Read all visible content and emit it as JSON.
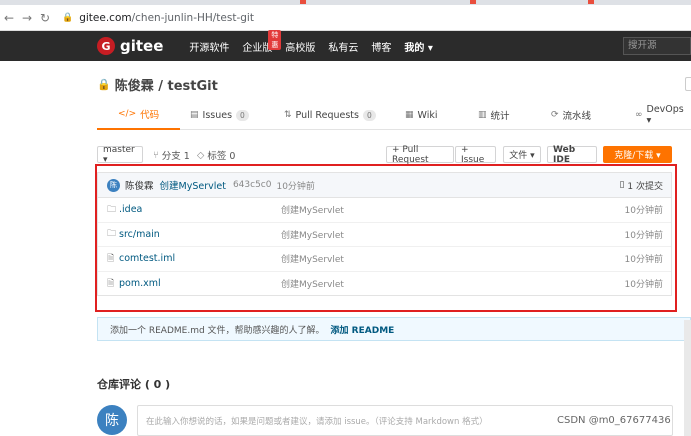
{
  "browser": {
    "back": "←",
    "forward": "→",
    "reload": "↻",
    "url_host": "gitee.com",
    "url_path": "/chen-junlin-HH/test-git"
  },
  "header": {
    "logo_badge": "G",
    "logo_text": "gitee",
    "nav": [
      "开源软件",
      "企业版",
      "高校版",
      "私有云",
      "博客",
      "我的 ▾"
    ],
    "enterprise_badge": "特惠",
    "search_placeholder": "搜开源"
  },
  "repo": {
    "title": "陈俊霖 / testGit",
    "tabs": [
      {
        "icon": "</>",
        "label": "代码"
      },
      {
        "icon": "▤",
        "label": "Issues",
        "count": "0"
      },
      {
        "icon": "⇅",
        "label": "Pull Requests",
        "count": "0"
      },
      {
        "icon": "▦",
        "label": "Wiki"
      },
      {
        "icon": "▥",
        "label": "统计"
      },
      {
        "icon": "⟳",
        "label": "流水线"
      },
      {
        "icon": "∞",
        "label": "DevOps ▾"
      }
    ]
  },
  "toolbar": {
    "branch": "master ▾",
    "branches": "分支 1",
    "tags": "标签 0",
    "pull_request": "+ Pull Request",
    "issue": "+ Issue",
    "file": "文件 ▾",
    "web_ide": "Web IDE",
    "clone": "克隆/下载 ▾"
  },
  "commit": {
    "avatar": "陈",
    "author": "陈俊霖",
    "message": "创建MyServlet",
    "hash": "643c5c0",
    "time": "10分钟前",
    "count": "1 次提交"
  },
  "files": [
    {
      "icon": "folder",
      "name": ".idea",
      "message": "创建MyServlet",
      "time": "10分钟前"
    },
    {
      "icon": "folder",
      "name": "src/main",
      "message": "创建MyServlet",
      "time": "10分钟前"
    },
    {
      "icon": "file",
      "name": "comtest.iml",
      "message": "创建MyServlet",
      "time": "10分钟前"
    },
    {
      "icon": "file",
      "name": "pom.xml",
      "message": "创建MyServlet",
      "time": "10分钟前"
    }
  ],
  "readme": {
    "text": "添加一个 README.md 文件，帮助感兴趣的人了解。",
    "link": "添加 README"
  },
  "comments": {
    "title": "仓库评论 ( 0 )",
    "avatar": "陈",
    "placeholder": "在此输入你想说的话，如果是问题或者建议，请添加 issue。（评论支持 Markdown 格式）"
  },
  "watermark": "CSDN @m0_67677436",
  "colors": {
    "accent": "#fe7300",
    "header_bg": "#2b2b2b",
    "link": "#005980",
    "highlight": "#e02020"
  }
}
